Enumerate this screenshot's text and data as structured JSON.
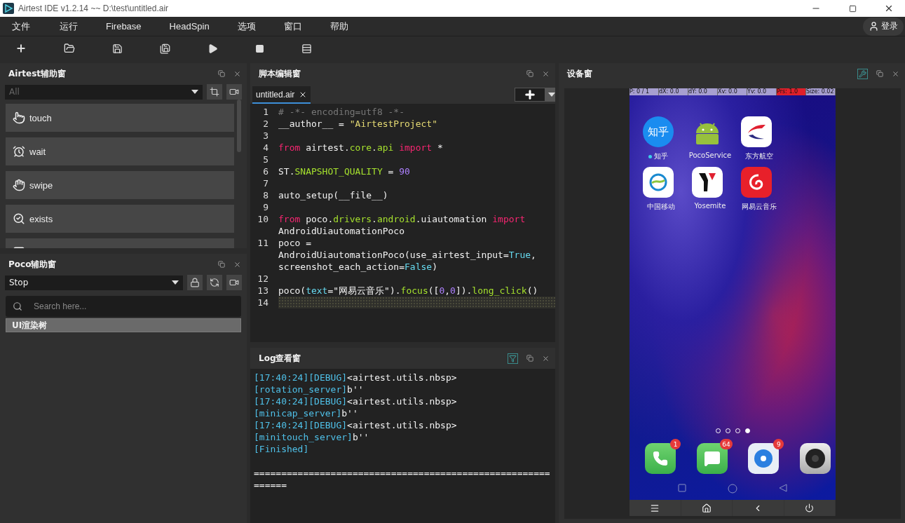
{
  "window": {
    "title": "Airtest IDE v1.2.14 ~~ D:\\test\\untitled.air"
  },
  "menu": [
    "文件",
    "运行",
    "Firebase",
    "HeadSpin",
    "选项",
    "窗口",
    "帮助"
  ],
  "login": "登录",
  "airtest_panel": {
    "title": "Airtest辅助窗",
    "filter": "All",
    "actions": [
      {
        "label": "touch",
        "kind": "touch"
      },
      {
        "label": "wait",
        "kind": "wait"
      },
      {
        "label": "swipe",
        "kind": "swipe"
      },
      {
        "label": "exists",
        "kind": "exists"
      },
      {
        "kind": "snapshot"
      }
    ]
  },
  "poco_panel": {
    "title": "Poco辅助窗",
    "mode": "Stop",
    "search": {
      "placeholder": "Search here..."
    },
    "tree": [
      {
        "label": "UI渲染树",
        "selected": true
      }
    ]
  },
  "editor": {
    "title": "脚本编辑窗",
    "tabs": [
      {
        "label": "untitled.air",
        "selected": true
      }
    ],
    "lines": [
      {
        "number": "1",
        "current": false,
        "tokens": [
          {
            "text": "# -*- encoding=utf8 -*-",
            "kind": "comment"
          }
        ]
      },
      {
        "number": "2",
        "current": false,
        "tokens": [
          {
            "text": "__author__ = ",
            "kind": "plain"
          },
          {
            "text": "\"AirtestProject\"",
            "kind": "string"
          }
        ]
      },
      {
        "number": "3",
        "current": false
      },
      {
        "number": "4",
        "current": false,
        "tokens": [
          {
            "text": "from",
            "kind": "keyword"
          },
          {
            "text": " airtest.",
            "kind": "plain"
          },
          {
            "text": "core",
            "kind": "name"
          },
          {
            "text": ".",
            "kind": "plain"
          },
          {
            "text": "api",
            "kind": "name"
          },
          {
            "text": " import",
            "kind": "keyword"
          },
          {
            "text": " *",
            "kind": "plain"
          }
        ]
      },
      {
        "number": "5",
        "current": false
      },
      {
        "number": "6",
        "current": false,
        "tokens": [
          {
            "text": "ST.",
            "kind": "plain"
          },
          {
            "text": "SNAPSHOT_QUALITY",
            "kind": "name"
          },
          {
            "text": " = ",
            "kind": "plain"
          },
          {
            "text": "90",
            "kind": "number"
          }
        ]
      },
      {
        "number": "7",
        "current": false
      },
      {
        "number": "8",
        "current": false,
        "tokens": [
          {
            "text": "auto_setup(__file__)",
            "kind": "plain"
          }
        ]
      },
      {
        "number": "9",
        "current": false
      },
      {
        "number": "10",
        "current": false,
        "tokens": [
          {
            "text": "from",
            "kind": "keyword"
          },
          {
            "text": " poco.",
            "kind": "plain"
          },
          {
            "text": "drivers",
            "kind": "name"
          },
          {
            "text": ".",
            "kind": "plain"
          },
          {
            "text": "android",
            "kind": "name"
          },
          {
            "text": ".uiautomation ",
            "kind": "plain"
          },
          {
            "text": "import",
            "kind": "keyword"
          },
          {
            "text": " AndroidUiautomationPoco",
            "kind": "plain"
          }
        ]
      },
      {
        "number": "11",
        "current": false,
        "tokens": [
          {
            "text": "poco = AndroidUiautomationPoco(use_airtest_input=",
            "kind": "plain"
          },
          {
            "text": "True",
            "kind": "builtin"
          },
          {
            "text": ", screenshot_each_action=",
            "kind": "plain"
          },
          {
            "text": "False",
            "kind": "builtin"
          },
          {
            "text": ")",
            "kind": "plain"
          }
        ]
      },
      {
        "number": "12",
        "current": false
      },
      {
        "number": "13",
        "current": false,
        "tokens": [
          {
            "text": "poco(",
            "kind": "plain"
          },
          {
            "text": "text",
            "kind": "builtin"
          },
          {
            "text": "=\"网易云音乐\").",
            "kind": "plain"
          },
          {
            "text": "focus",
            "kind": "name"
          },
          {
            "text": "([",
            "kind": "plain"
          },
          {
            "text": "0",
            "kind": "number"
          },
          {
            "text": ",",
            "kind": "plain"
          },
          {
            "text": "0",
            "kind": "number"
          },
          {
            "text": "]).",
            "kind": "plain"
          },
          {
            "text": "long_click",
            "kind": "name"
          },
          {
            "text": "()",
            "kind": "plain"
          }
        ]
      },
      {
        "number": "14",
        "current": true
      }
    ]
  },
  "log": {
    "title": "Log查看窗",
    "lines": [
      {
        "kind": "entry",
        "tokens": [
          {
            "text": "[17:40:24][DEBUG]",
            "kind": "tag"
          },
          {
            "text": "<airtest.utils.nbsp>",
            "kind": "plain"
          }
        ]
      },
      {
        "kind": "entry",
        "tokens": [
          {
            "text": "[rotation_server]",
            "kind": "tag"
          },
          {
            "text": "b''",
            "kind": "plain"
          }
        ]
      },
      {
        "kind": "entry",
        "tokens": [
          {
            "text": "[17:40:24][DEBUG]",
            "kind": "tag"
          },
          {
            "text": "<airtest.utils.nbsp>",
            "kind": "plain"
          }
        ]
      },
      {
        "kind": "entry",
        "tokens": [
          {
            "text": "[minicap_server]",
            "kind": "tag"
          },
          {
            "text": "b''",
            "kind": "plain"
          }
        ]
      },
      {
        "kind": "entry",
        "tokens": [
          {
            "text": "[17:40:24][DEBUG]",
            "kind": "tag"
          },
          {
            "text": "<airtest.utils.nbsp>",
            "kind": "plain"
          }
        ]
      },
      {
        "kind": "entry",
        "tokens": [
          {
            "text": "[minitouch_server]",
            "kind": "tag"
          },
          {
            "text": "b''",
            "kind": "plain"
          }
        ]
      },
      {
        "kind": "entry",
        "tokens": [
          {
            "text": "[Finished]",
            "kind": "tag"
          }
        ]
      },
      {
        "kind": "separator",
        "tokens": [
          {
            "text": "======================================================",
            "kind": "plain"
          }
        ]
      },
      {
        "kind": "entry",
        "tokens": [
          {
            "text": "======",
            "kind": "plain"
          }
        ]
      }
    ]
  },
  "device": {
    "title": "设备窗",
    "overlay": [
      {
        "text": "P: 0 / 1",
        "alert": false
      },
      {
        "text": "dX: 0.0",
        "alert": false
      },
      {
        "text": "dY: 0.0",
        "alert": false
      },
      {
        "text": "Xv: 0.0",
        "alert": false
      },
      {
        "text": "Yv: 0.0",
        "alert": false
      },
      {
        "text": "Prs: 1.0",
        "alert": true
      },
      {
        "text": "Size: 0.02",
        "alert": false
      }
    ],
    "apps": [
      {
        "label": "知乎",
        "kind": "zhihu",
        "icon_text": "知乎",
        "new": true
      },
      {
        "label": "PocoService",
        "kind": "android",
        "new": false
      },
      {
        "label": "东方航空",
        "kind": "airline",
        "new": false
      },
      {
        "label": "中国移动",
        "kind": "mobile",
        "new": false
      },
      {
        "label": "Yosemite",
        "kind": "yosemite",
        "new": false
      },
      {
        "label": "网易云音乐",
        "kind": "music",
        "new": false
      }
    ],
    "pages": [
      {
        "selected": false
      },
      {
        "selected": false
      },
      {
        "selected": false
      },
      {
        "selected": true
      }
    ],
    "dock": [
      {
        "kind": "phone",
        "badge": "1"
      },
      {
        "kind": "message",
        "badge": "64"
      },
      {
        "kind": "browser",
        "badge": "9"
      },
      {
        "kind": "camera"
      }
    ]
  }
}
